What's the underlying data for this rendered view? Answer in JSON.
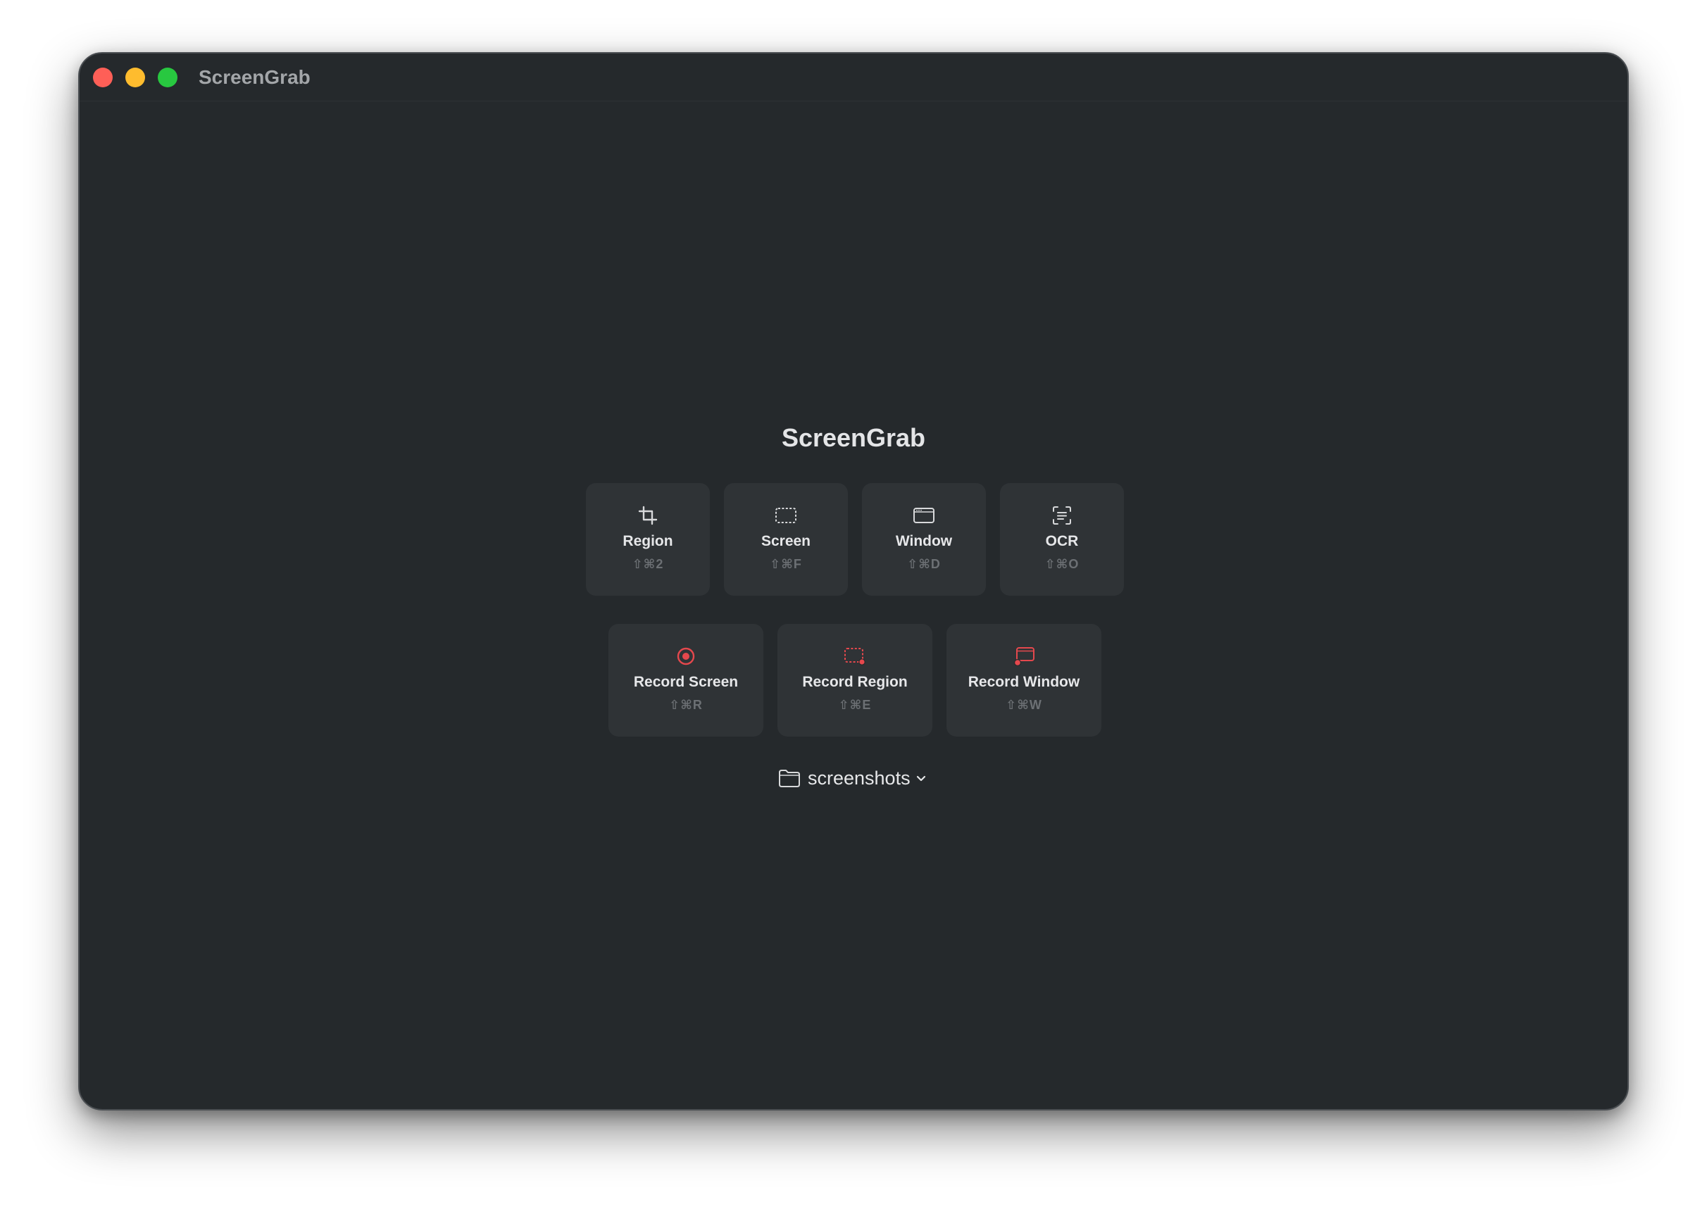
{
  "window": {
    "title": "ScreenGrab"
  },
  "main": {
    "app_title": "ScreenGrab"
  },
  "capture_actions": [
    {
      "label": "Region",
      "shortcut": "⇧⌘2",
      "icon": "crop-icon"
    },
    {
      "label": "Screen",
      "shortcut": "⇧⌘F",
      "icon": "dashed-rectangle-icon"
    },
    {
      "label": "Window",
      "shortcut": "⇧⌘D",
      "icon": "window-icon"
    },
    {
      "label": "OCR",
      "shortcut": "⇧⌘O",
      "icon": "text-scan-icon"
    }
  ],
  "record_actions": [
    {
      "label": "Record Screen",
      "shortcut": "⇧⌘R",
      "icon": "record-circle-icon"
    },
    {
      "label": "Record Region",
      "shortcut": "⇧⌘E",
      "icon": "record-region-icon"
    },
    {
      "label": "Record Window",
      "shortcut": "⇧⌘W",
      "icon": "record-window-icon"
    }
  ],
  "save_location": {
    "folder": "screenshots",
    "icon": "folder-icon"
  },
  "colors": {
    "background": "#25292c",
    "tile": "#2f3336",
    "record_accent": "#e5484d",
    "traffic_close": "#fe5f57",
    "traffic_minimize": "#febc2e",
    "traffic_zoom": "#28c840"
  }
}
